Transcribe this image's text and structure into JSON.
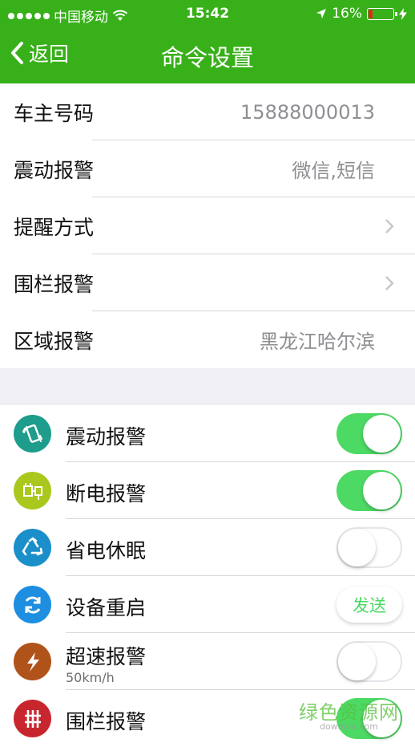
{
  "status_bar": {
    "carrier": "中国移动",
    "time": "15:42",
    "battery": "16%",
    "battery_level": 0.16
  },
  "nav": {
    "back_label": "返回",
    "title": "命令设置"
  },
  "settings": [
    {
      "label": "车主号码",
      "value": "15888000013"
    },
    {
      "label": "震动报警",
      "value": "微信,短信"
    },
    {
      "label": "提醒方式",
      "value": ""
    },
    {
      "label": "围栏报警",
      "value": ""
    },
    {
      "label": "区域报警",
      "value": "黑龙江哈尔滨"
    }
  ],
  "commands": [
    {
      "label": "震动报警",
      "icon": "vibrate-phone-icon",
      "color": "#1e9c8c",
      "control": "toggle",
      "on": true
    },
    {
      "label": "断电报警",
      "icon": "power-plug-icon",
      "color": "#a8c81e",
      "control": "toggle",
      "on": true
    },
    {
      "label": "省电休眠",
      "icon": "recycle-icon",
      "color": "#1b8fc9",
      "control": "toggle",
      "on": false
    },
    {
      "label": "设备重启",
      "icon": "refresh-icon",
      "color": "#1e8ee0",
      "control": "button",
      "button_label": "发送"
    },
    {
      "label": "超速报警",
      "sub": "50km/h",
      "icon": "lightning-icon",
      "color": "#b0531a",
      "control": "toggle",
      "on": false
    },
    {
      "label": "围栏报警",
      "icon": "fence-icon",
      "color": "#c8262e",
      "control": "toggle",
      "on": true
    }
  ],
  "watermark": {
    "text": "绿色资源网",
    "sub": "downxia.com"
  }
}
